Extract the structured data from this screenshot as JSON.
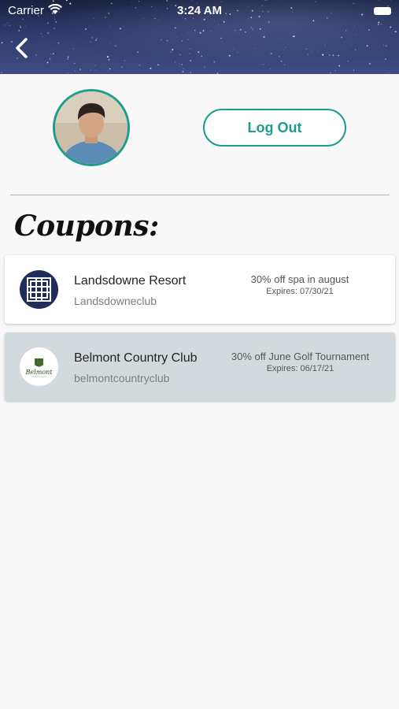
{
  "status_bar": {
    "carrier": "Carrier",
    "time": "3:24 AM",
    "icons": [
      "wifi-icon",
      "battery-icon"
    ]
  },
  "header": {
    "back_icon": "chevron-left-icon"
  },
  "profile": {
    "avatar": "avatar",
    "logout_label": "Log Out",
    "accent_color": "#1e9d8e"
  },
  "coupons": {
    "title": "Coupons:",
    "items": [
      {
        "name": "Landsdowne Resort",
        "handle": "Landsdowneclub",
        "offer": "30% off spa in august",
        "expires": "Expires: 07/30/21",
        "logo": "landsdowne-logo-icon"
      },
      {
        "name": "Belmont Country Club",
        "handle": "belmontcountryclub",
        "offer": "30% off June Golf Tournament",
        "expires": "Expires: 06/17/21",
        "logo": "belmont-logo-icon",
        "logo_text": "Belmont"
      }
    ]
  }
}
